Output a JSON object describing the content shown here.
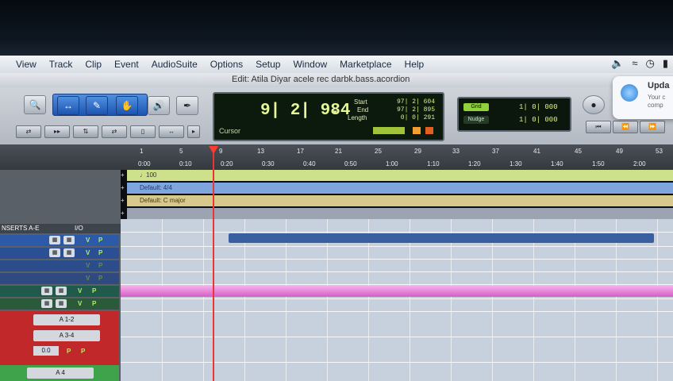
{
  "menu": [
    "View",
    "Track",
    "Clip",
    "Event",
    "AudioSuite",
    "Options",
    "Setup",
    "Window",
    "Marketplace",
    "Help"
  ],
  "window_title": "Edit: Atila Diyar acele rec darbk.bass.acordion",
  "counter": {
    "main": "9| 2| 984",
    "cursor_label": "Cursor",
    "start_label": "Start",
    "start_value": "97| 2| 604",
    "end_label": "End",
    "end_value": "97| 2| 895",
    "length_label": "Length",
    "length_value": "0| 0| 291"
  },
  "grid": {
    "grid_label": "Grid",
    "grid_value": "1| 0| 000",
    "nudge_label": "Nudge",
    "nudge_value": "1| 0| 000"
  },
  "notification": {
    "title": "Upda",
    "text_line1": "Your c",
    "text_line2": "comp"
  },
  "ruler": {
    "bars": [
      "1",
      "5",
      "9",
      "13",
      "17",
      "21",
      "25",
      "29",
      "33",
      "37",
      "41",
      "45",
      "49",
      "53"
    ],
    "times": [
      "0:00",
      "0:10",
      "0:20",
      "0:30",
      "0:40",
      "0:50",
      "1:00",
      "1:10",
      "1:20",
      "1:30",
      "1:40",
      "1:50",
      "2:00"
    ]
  },
  "tempo": "100",
  "meter": "Default: 4/4",
  "key": "Default: C major",
  "mix_header": {
    "inserts": "NSERTS A-E",
    "io": "I/O"
  },
  "track_buttons": {
    "v": "V",
    "p": "P",
    "io_a12": "A 1-2",
    "io_a34": "A 3-4",
    "io_a4": "A 4",
    "vol": "0.0"
  },
  "colors": {
    "accent_blue": "#2f6fd0",
    "counter_green": "#c9e96b",
    "clip_blue": "#3a5fa0",
    "clip_pink": "#e06ad0",
    "tempo_lane": "#cfe08a",
    "meter_lane": "#7fa5de",
    "key_lane": "#d7c98c"
  }
}
